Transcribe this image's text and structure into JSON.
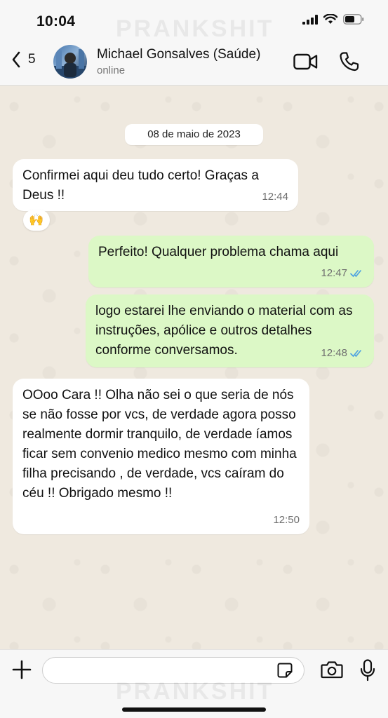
{
  "status_bar": {
    "time": "10:04"
  },
  "header": {
    "back_count": "5",
    "contact_name": "Michael Gonsalves (Saúde)",
    "contact_status": "online"
  },
  "watermark": "PRANKSHIT",
  "chat": {
    "date": "08 de maio de 2023",
    "messages": [
      {
        "direction": "in",
        "text": "Confirmei aqui deu tudo certo! Graças a Deus !!",
        "time": "12:44",
        "reaction": "🙌"
      },
      {
        "direction": "out",
        "text": "Perfeito! Qualquer problema chama aqui",
        "time": "12:47",
        "status": "read"
      },
      {
        "direction": "out",
        "text": "logo estarei lhe enviando o material com as instruções, apólice  e outros detalhes conforme conversamos.",
        "time": "12:48",
        "status": "read"
      },
      {
        "direction": "in",
        "text": "OOoo Cara !! Olha não sei o que seria de nós se não fosse por vcs, de verdade agora posso realmente dormir tranquilo, de verdade íamos ficar sem convenio medico mesmo com minha filha precisando , de verdade, vcs caíram do céu !! Obrigado mesmo !!",
        "time": "12:50"
      }
    ]
  },
  "input": {
    "placeholder": ""
  },
  "colors": {
    "outgoing": "#dcf8c6",
    "incoming": "#ffffff",
    "read_ticks": "#4fa3e0",
    "chat_bg": "#efe9df"
  }
}
